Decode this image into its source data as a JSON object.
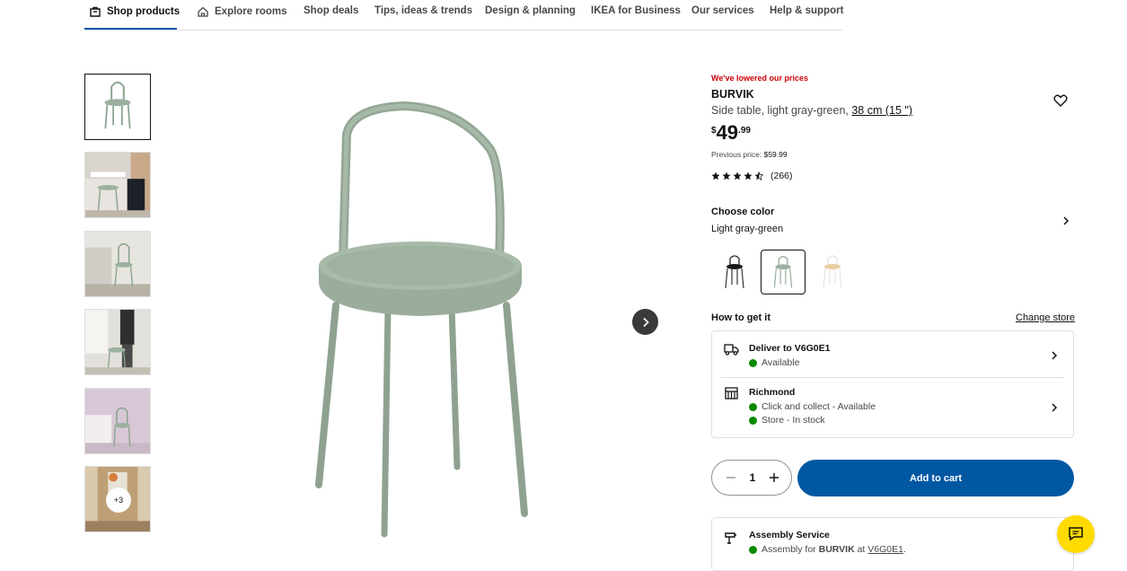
{
  "nav": {
    "items": [
      {
        "label": "Shop products",
        "active": true,
        "icon": "shopping-bag-icon"
      },
      {
        "label": "Explore rooms",
        "icon": "home-icon"
      },
      {
        "label": "Shop deals"
      },
      {
        "label": "Tips, ideas & trends"
      },
      {
        "label": "Design & planning"
      },
      {
        "label": "IKEA for Business"
      },
      {
        "label": "Our services"
      },
      {
        "label": "Help & support"
      }
    ]
  },
  "gallery": {
    "more_count": "+3",
    "next_icon": "chevron-right-icon"
  },
  "product": {
    "price_badge": "We've lowered our prices",
    "name": "BURVIK",
    "description": "Side table, light gray-green, ",
    "size": "38 cm (15 \")",
    "price": {
      "currency": "$",
      "whole": "49",
      "decimal": ".99"
    },
    "previous_price_label": "Previous price:",
    "previous_price": "$59.99",
    "rating": 4.5,
    "review_count": "(266)",
    "colors": {
      "label": "Choose color",
      "selected": "Light gray-green",
      "options": [
        "black",
        "light gray-green",
        "white/birch"
      ]
    }
  },
  "delivery": {
    "title": "How to get it",
    "change_store": "Change store",
    "deliver_title": "Deliver to V6G0E1",
    "deliver_status": "Available",
    "store_title": "Richmond",
    "store_collect": "Click and collect - Available",
    "store_stock": "Store - In stock",
    "status_color": "#0a8a00"
  },
  "cart": {
    "quantity": "1",
    "add_label": "Add to cart",
    "button_color": "#0058a3"
  },
  "assembly": {
    "title": "Assembly Service",
    "prefix": "Assembly for ",
    "product": "BURVIK",
    "mid": " at ",
    "postal": "V6G0E1",
    "end": "."
  },
  "colors": {
    "accent": "#0058a3",
    "sale": "#cc0008",
    "chat": "#ffdb00"
  }
}
